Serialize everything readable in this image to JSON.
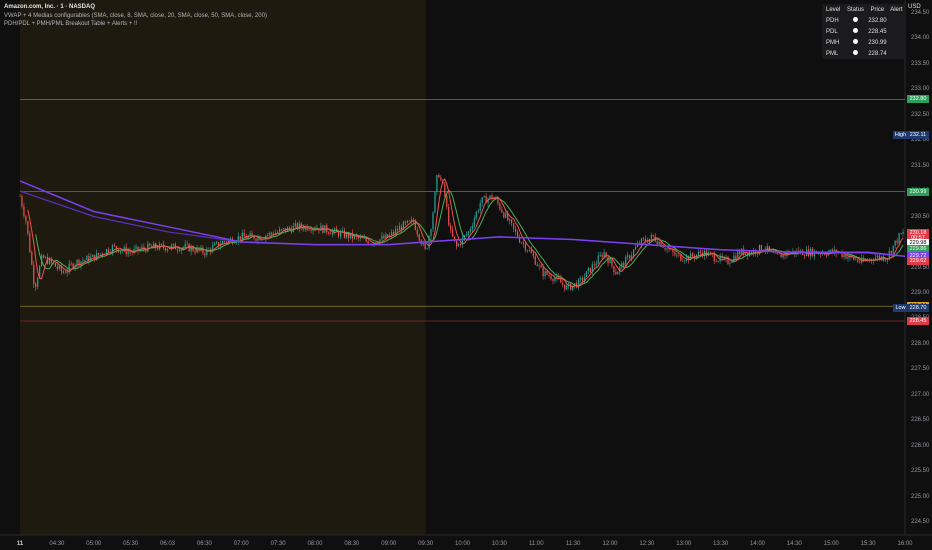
{
  "legend": {
    "ticker": "Amazon.com, Inc. · 1 · NASDAQ",
    "line2": "VWAP + 4 Medias configurables (SMA, close, 8, SMA, close, 20, SMA, close, 50, SMA, close, 200)",
    "line3": "PDH/PDL + PMH/PML Breakout Table + Alerts + !!"
  },
  "currency": "USD",
  "table": {
    "headers": [
      "Level",
      "Status",
      "Price",
      "Alert"
    ],
    "rows": [
      {
        "level": "PDH",
        "price": "232.80"
      },
      {
        "level": "PDL",
        "price": "228.45"
      },
      {
        "level": "PMH",
        "price": "230.99"
      },
      {
        "level": "PML",
        "price": "228.74"
      }
    ]
  },
  "y_axis": {
    "min": 224.25,
    "max": 234.75,
    "ticks": [
      "234.50",
      "234.00",
      "233.50",
      "233.00",
      "232.50",
      "232.00",
      "231.50",
      "231.00",
      "230.50",
      "230.00",
      "229.50",
      "229.00",
      "228.50",
      "228.00",
      "227.50",
      "227.00",
      "226.50",
      "226.00",
      "225.50",
      "225.00",
      "224.50"
    ]
  },
  "x_axis": {
    "start_time": "04:00",
    "end_time": "16:00",
    "labels": [
      {
        "t": "04:00",
        "text": "11",
        "day": true
      },
      {
        "t": "04:30",
        "text": "04:30"
      },
      {
        "t": "05:00",
        "text": "05:00"
      },
      {
        "t": "05:30",
        "text": "05:30"
      },
      {
        "t": "06:00",
        "text": "06:03"
      },
      {
        "t": "06:30",
        "text": "06:30"
      },
      {
        "t": "07:00",
        "text": "07:00"
      },
      {
        "t": "07:30",
        "text": "07:30"
      },
      {
        "t": "08:00",
        "text": "08:00"
      },
      {
        "t": "08:30",
        "text": "08:30"
      },
      {
        "t": "09:00",
        "text": "09:00"
      },
      {
        "t": "09:30",
        "text": "09:30"
      },
      {
        "t": "10:00",
        "text": "10:00"
      },
      {
        "t": "10:30",
        "text": "10:30"
      },
      {
        "t": "11:00",
        "text": "11:00"
      },
      {
        "t": "11:30",
        "text": "11:30"
      },
      {
        "t": "12:00",
        "text": "12:00"
      },
      {
        "t": "12:30",
        "text": "12:30"
      },
      {
        "t": "13:00",
        "text": "13:00"
      },
      {
        "t": "13:30",
        "text": "13:30"
      },
      {
        "t": "14:00",
        "text": "14:00"
      },
      {
        "t": "14:30",
        "text": "14:30"
      },
      {
        "t": "15:00",
        "text": "15:00"
      },
      {
        "t": "15:30",
        "text": "15:30"
      },
      {
        "t": "16:00",
        "text": "16:00"
      }
    ]
  },
  "premarket": {
    "start": "04:00",
    "end": "09:30",
    "color": "#1f1a0f"
  },
  "levels": [
    {
      "name": "PDH",
      "price": 232.8,
      "label": "232.80",
      "color": "#3a8a5a",
      "badge": "#2e9e5b"
    },
    {
      "name": "PMH",
      "price": 230.99,
      "label": "230.99",
      "color": "#2f7a6a",
      "badge": "#2e9e5b"
    },
    {
      "name": "PML",
      "price": 228.74,
      "label": "228.74",
      "color": "#8a7a20",
      "badge": "#e0a020"
    },
    {
      "name": "PDL",
      "price": 228.45,
      "label": "228.45",
      "color": "#8a2a2a",
      "badge": "#e03a48"
    }
  ],
  "high_low": [
    {
      "tag": "High",
      "price": 232.11,
      "label": "232.11",
      "badge": "#1e3a6e"
    },
    {
      "tag": "Low",
      "price": 228.7,
      "label": "228.70",
      "badge": "#1e3a6e"
    }
  ],
  "price_badges": [
    {
      "price": 230.18,
      "label": "230.18",
      "bg": "#e03a48",
      "fg": "#ffffff"
    },
    {
      "price": 230.07,
      "label": "00:57",
      "bg": "#e03a48",
      "fg": "#ffffff"
    },
    {
      "price": 229.98,
      "label": "229.98",
      "bg": "#ffffff",
      "fg": "#000000"
    },
    {
      "price": 229.86,
      "label": "229.86",
      "bg": "#2e9e5b",
      "fg": "#ffffff"
    },
    {
      "price": 229.72,
      "label": "229.72",
      "bg": "#7b3ff2",
      "fg": "#ffffff"
    },
    {
      "price": 229.62,
      "label": "229.62",
      "bg": "#e03a48",
      "fg": "#ffffff"
    }
  ],
  "colors": {
    "up": "#26a69a",
    "down": "#ef5350",
    "vwap": "#7b3ff2",
    "sma8": "#ef5350",
    "sma20": "#4caf50",
    "sma200": "#7b3ff2"
  },
  "chart_data": {
    "type": "candlestick",
    "title": "Amazon.com, Inc. · 1 · NASDAQ",
    "close_path": [
      [
        "04:00",
        230.9
      ],
      [
        "04:05",
        230.4
      ],
      [
        "04:12",
        229.1
      ],
      [
        "04:18",
        229.7
      ],
      [
        "04:25",
        229.6
      ],
      [
        "04:35",
        229.4
      ],
      [
        "04:45",
        229.6
      ],
      [
        "05:00",
        229.7
      ],
      [
        "05:15",
        229.9
      ],
      [
        "05:30",
        229.8
      ],
      [
        "05:45",
        229.9
      ],
      [
        "06:00",
        229.9
      ],
      [
        "06:15",
        229.9
      ],
      [
        "06:30",
        229.8
      ],
      [
        "06:45",
        230.0
      ],
      [
        "07:00",
        230.1
      ],
      [
        "07:15",
        230.1
      ],
      [
        "07:30",
        230.2
      ],
      [
        "07:45",
        230.3
      ],
      [
        "08:00",
        230.3
      ],
      [
        "08:15",
        230.2
      ],
      [
        "08:30",
        230.1
      ],
      [
        "08:45",
        230.0
      ],
      [
        "09:00",
        230.1
      ],
      [
        "09:10",
        230.3
      ],
      [
        "09:20",
        230.4
      ],
      [
        "09:30",
        229.8
      ],
      [
        "09:35",
        230.4
      ],
      [
        "09:40",
        231.4
      ],
      [
        "09:45",
        231.0
      ],
      [
        "09:50",
        230.2
      ],
      [
        "09:55",
        229.9
      ],
      [
        "10:05",
        230.2
      ],
      [
        "10:15",
        230.8
      ],
      [
        "10:25",
        230.9
      ],
      [
        "10:35",
        230.5
      ],
      [
        "10:45",
        230.1
      ],
      [
        "10:55",
        229.8
      ],
      [
        "11:05",
        229.4
      ],
      [
        "11:15",
        229.3
      ],
      [
        "11:25",
        229.1
      ],
      [
        "11:35",
        229.2
      ],
      [
        "11:45",
        229.5
      ],
      [
        "11:55",
        229.8
      ],
      [
        "12:05",
        229.4
      ],
      [
        "12:15",
        229.7
      ],
      [
        "12:25",
        230.0
      ],
      [
        "12:35",
        230.1
      ],
      [
        "12:45",
        229.9
      ],
      [
        "12:55",
        229.7
      ],
      [
        "13:05",
        229.7
      ],
      [
        "13:15",
        229.8
      ],
      [
        "13:25",
        229.7
      ],
      [
        "13:35",
        229.6
      ],
      [
        "13:45",
        229.8
      ],
      [
        "13:55",
        229.8
      ],
      [
        "14:05",
        229.9
      ],
      [
        "14:15",
        229.7
      ],
      [
        "14:25",
        229.8
      ],
      [
        "14:35",
        229.8
      ],
      [
        "14:45",
        229.8
      ],
      [
        "14:55",
        229.8
      ],
      [
        "15:05",
        229.8
      ],
      [
        "15:15",
        229.7
      ],
      [
        "15:25",
        229.6
      ],
      [
        "15:35",
        229.7
      ],
      [
        "15:45",
        229.7
      ],
      [
        "15:55",
        230.1
      ],
      [
        "16:00",
        230.2
      ]
    ],
    "vwap": [
      [
        "04:00",
        231.2
      ],
      [
        "05:00",
        230.6
      ],
      [
        "06:00",
        230.3
      ],
      [
        "07:00",
        230.0
      ],
      [
        "08:00",
        229.95
      ],
      [
        "09:00",
        229.95
      ],
      [
        "09:30",
        230.0
      ],
      [
        "10:30",
        230.1
      ],
      [
        "11:30",
        230.05
      ],
      [
        "12:30",
        229.95
      ],
      [
        "13:30",
        229.85
      ],
      [
        "14:30",
        229.8
      ],
      [
        "15:30",
        229.8
      ],
      [
        "16:00",
        229.72
      ]
    ],
    "sma200": [
      [
        "04:00",
        231.0
      ],
      [
        "05:00",
        230.5
      ],
      [
        "06:00",
        230.2
      ],
      [
        "07:00",
        230.0
      ],
      [
        "08:00",
        229.95
      ],
      [
        "09:00",
        229.95
      ],
      [
        "09:30",
        230.0
      ],
      [
        "10:30",
        230.1
      ],
      [
        "11:30",
        230.05
      ],
      [
        "12:30",
        229.95
      ],
      [
        "13:30",
        229.85
      ],
      [
        "14:30",
        229.8
      ],
      [
        "15:30",
        229.78
      ],
      [
        "16:00",
        229.72
      ]
    ]
  }
}
